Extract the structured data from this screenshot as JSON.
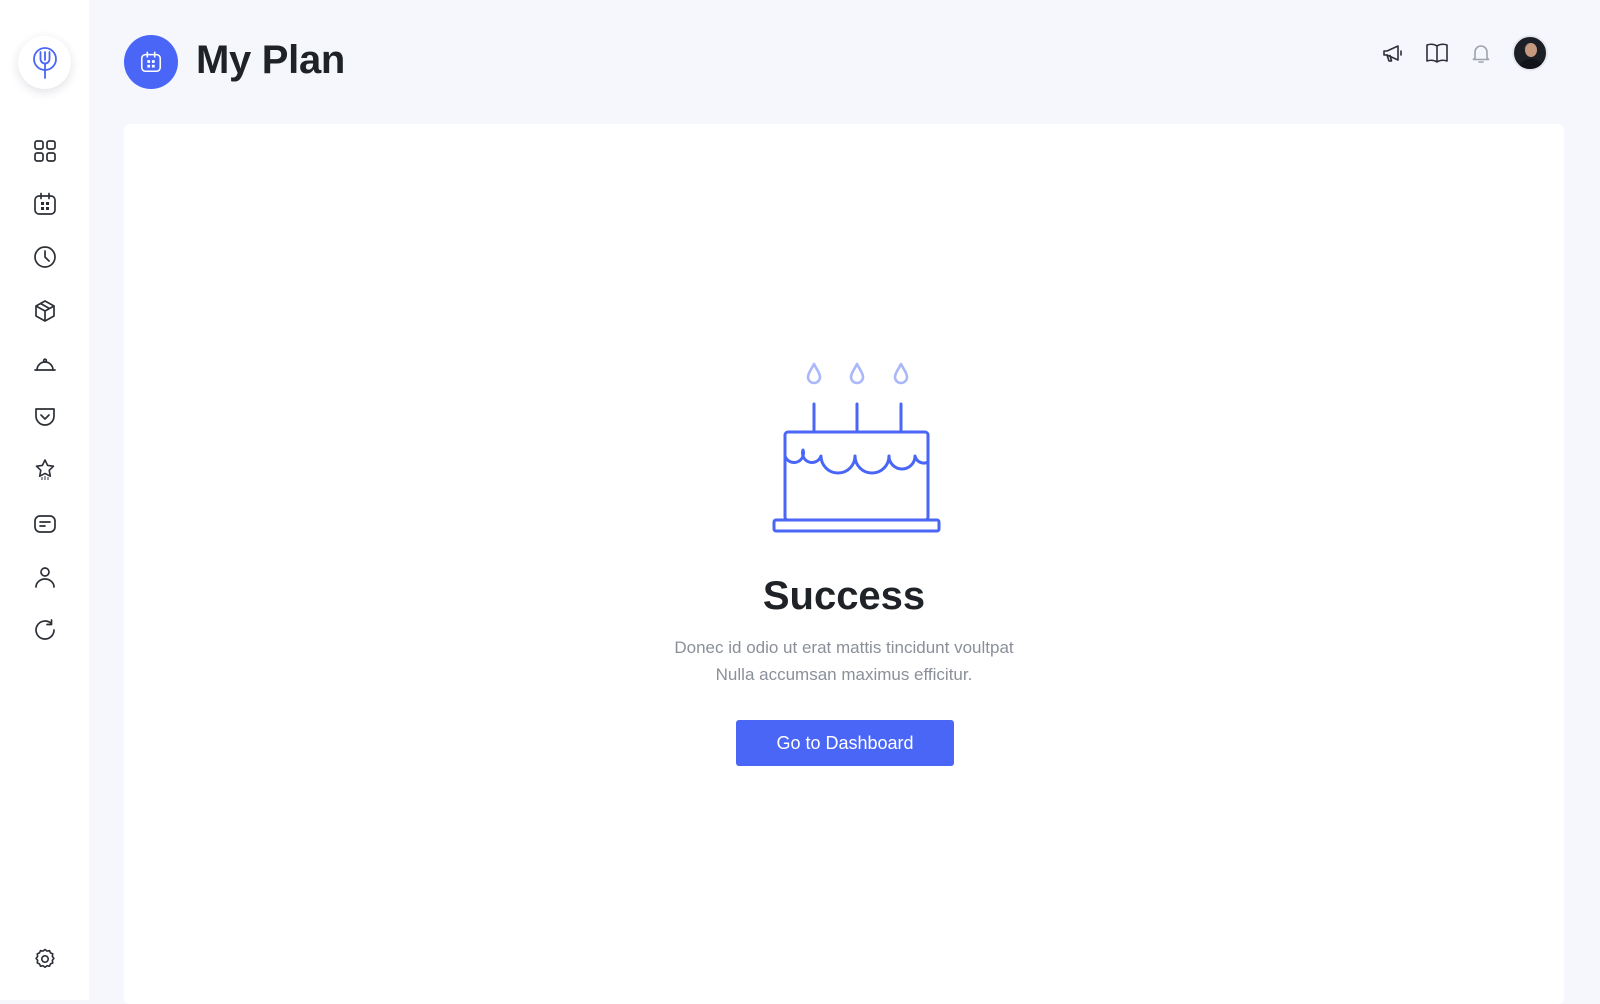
{
  "header": {
    "title": "My Plan"
  },
  "sidebar": {
    "items": [
      {
        "icon": "dashboard-grid-icon"
      },
      {
        "icon": "calendar-icon"
      },
      {
        "icon": "clock-icon"
      },
      {
        "icon": "box-icon"
      },
      {
        "icon": "cloche-icon"
      },
      {
        "icon": "pocket-icon"
      },
      {
        "icon": "star-badge-icon"
      },
      {
        "icon": "message-card-icon"
      },
      {
        "icon": "user-icon"
      },
      {
        "icon": "refresh-icon"
      }
    ],
    "footer_icon": "settings-icon"
  },
  "top_actions": [
    "megaphone-icon",
    "book-icon",
    "bell-icon",
    "avatar"
  ],
  "main": {
    "illustration": "birthday-cake-icon",
    "title": "Success",
    "text_line1": "Donec id odio ut erat mattis tincidunt voultpat",
    "text_line2": "Nulla accumsan maximus efficitur.",
    "button_label": "Go to Dashboard"
  },
  "colors": {
    "accent": "#4a66f7",
    "accent_light": "#aab8fb",
    "background": "#f6f7fc",
    "card": "#ffffff",
    "text_dark": "#1f2328",
    "text_muted": "#8a8f99"
  }
}
